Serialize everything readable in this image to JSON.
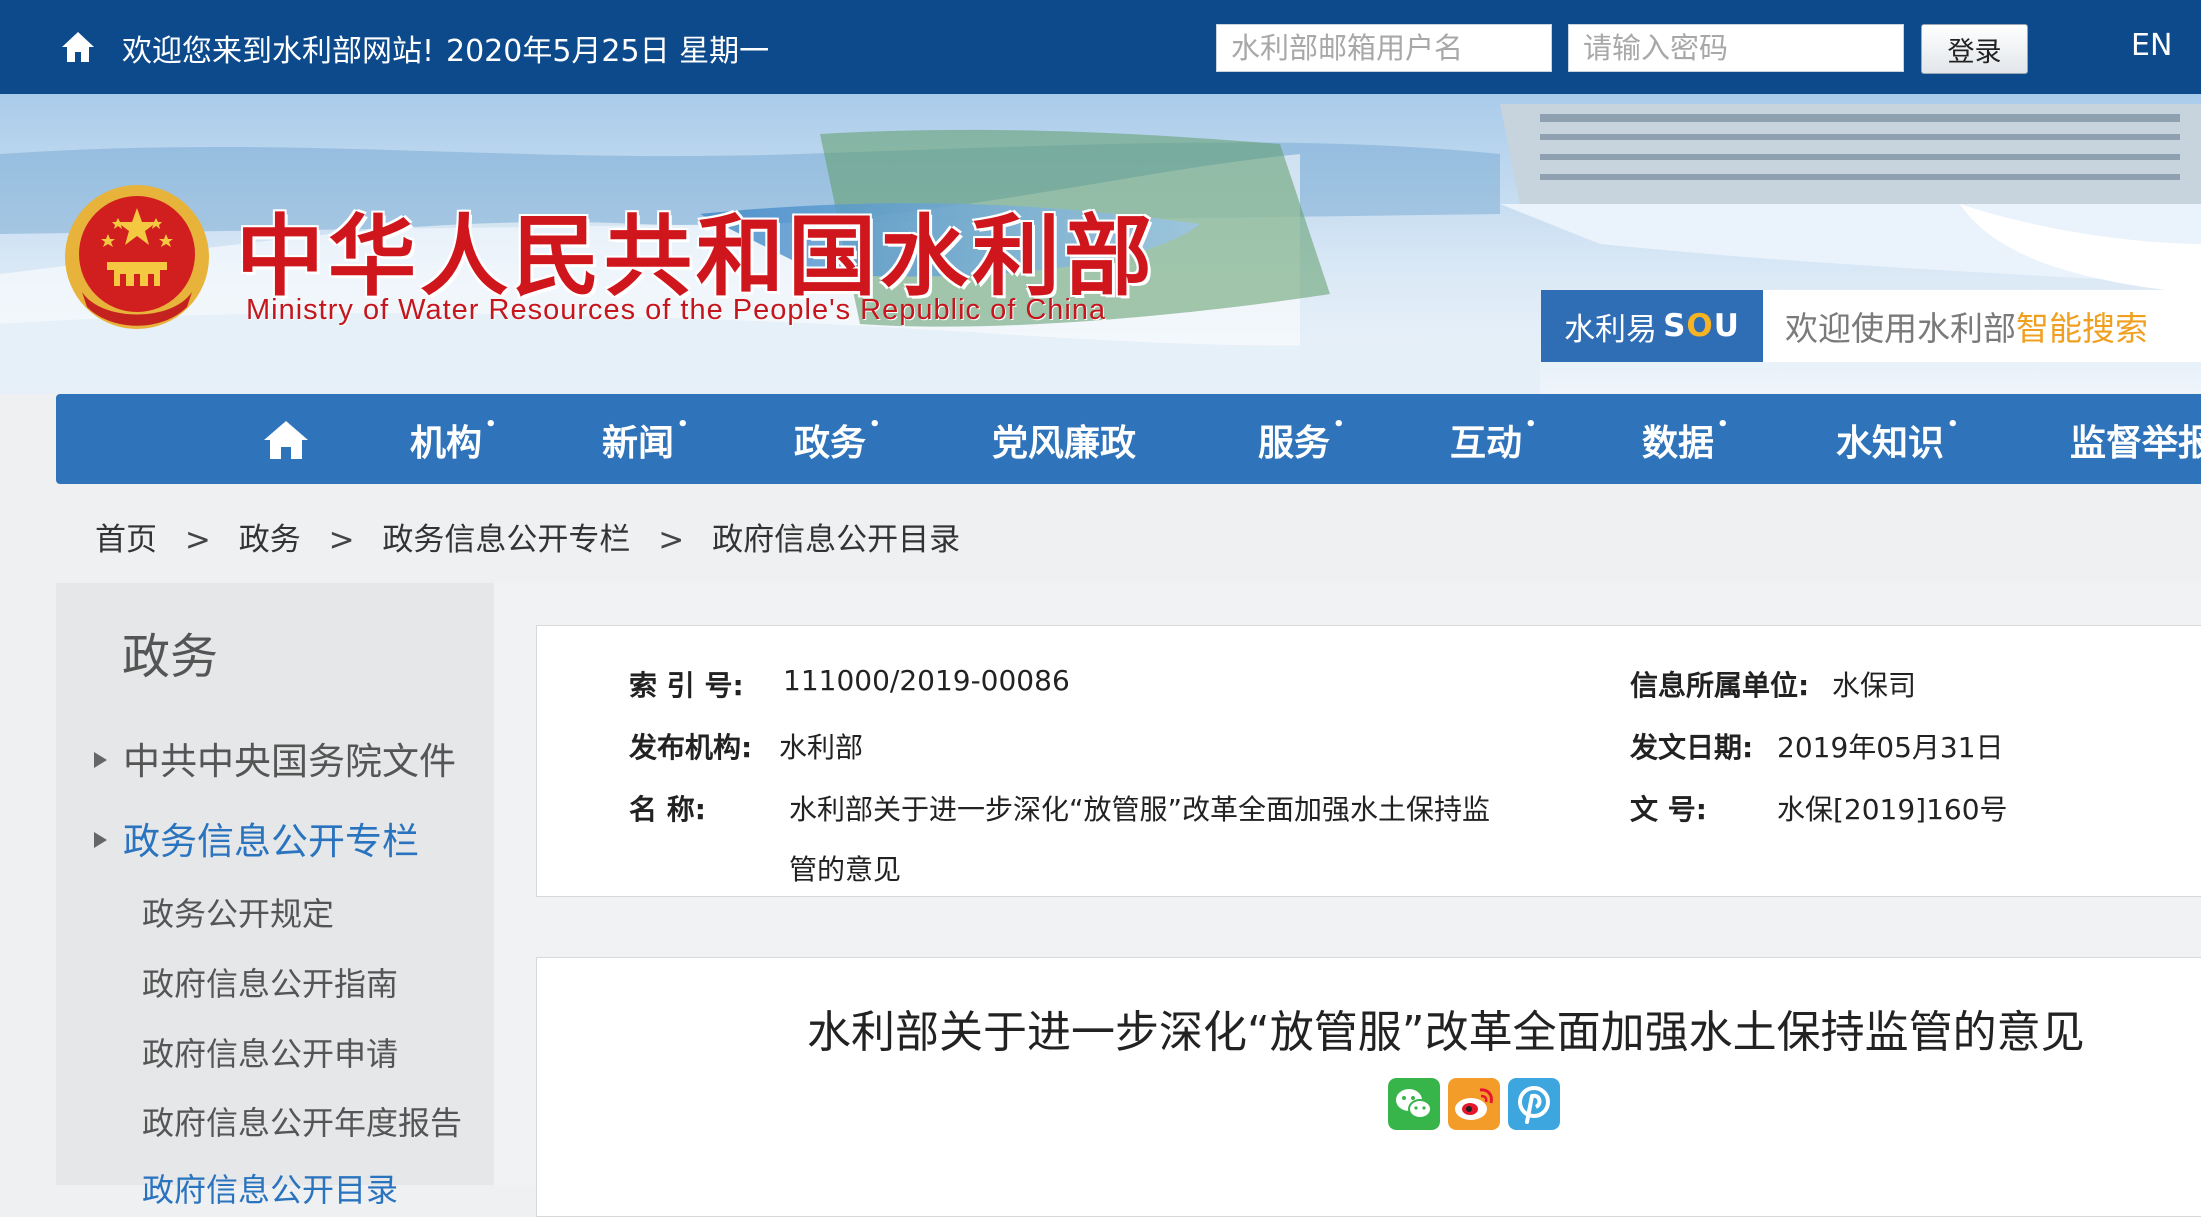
{
  "topbar": {
    "welcome": "欢迎您来到水利部网站!",
    "date": "2020年5月25日 星期一",
    "username_placeholder": "水利部邮箱用户名",
    "password_placeholder": "请输入密码",
    "login_label": "登录",
    "language_label": "EN",
    "home_icon": "home-icon"
  },
  "banner": {
    "title": "中华人民共和国水利部",
    "subtitle": "Ministry of Water Resources of the People's Republic of China",
    "emblem_icon": "national-emblem",
    "search_brand_prefix": "水利易",
    "search_brand_s": "S",
    "search_brand_o": "O",
    "search_brand_u": "U",
    "search_hint_prefix": "欢迎使用水利部",
    "search_hint_highlight": "智能搜索"
  },
  "nav": {
    "home_icon": "home-icon",
    "items": [
      {
        "label": "机构",
        "dropdown": true
      },
      {
        "label": "新闻",
        "dropdown": true
      },
      {
        "label": "政务",
        "dropdown": true
      },
      {
        "label": "党风廉政",
        "dropdown": false
      },
      {
        "label": "服务",
        "dropdown": true
      },
      {
        "label": "互动",
        "dropdown": true
      },
      {
        "label": "数据",
        "dropdown": true
      },
      {
        "label": "水知识",
        "dropdown": true
      },
      {
        "label": "监督举报",
        "dropdown": false
      }
    ],
    "dropdown_marker": "•"
  },
  "breadcrumb": {
    "items": [
      "首页",
      "政务",
      "政务信息公开专栏",
      "政府信息公开目录"
    ],
    "separator": ">"
  },
  "sidebar": {
    "title": "政务",
    "categories": [
      {
        "label": "中共中央国务院文件",
        "active": false
      },
      {
        "label": "政务信息公开专栏",
        "active": true
      }
    ],
    "subitems": [
      {
        "label": "政务公开规定",
        "active": false
      },
      {
        "label": "政府信息公开指南",
        "active": false
      },
      {
        "label": "政府信息公开申请",
        "active": false
      },
      {
        "label": "政府信息公开年度报告",
        "active": false
      },
      {
        "label": "政府信息公开目录",
        "active": true
      }
    ]
  },
  "meta": {
    "index_label": "索  引  号:",
    "index_value": "111000/2019-00086",
    "publisher_label": "发布机构:",
    "publisher_value": "水利部",
    "name_label": "名        称:",
    "name_value_line1": "水利部关于进一步深化“放管服”改革全面加强水土保持监",
    "name_value_line2": "管的意见",
    "unit_label": "信息所属单位:",
    "unit_value": "水保司",
    "date_label": "发文日期:",
    "date_value": "2019年05月31日",
    "doc_no_label": "文        号:",
    "doc_no_value": "水保[2019]160号"
  },
  "document": {
    "title": "水利部关于进一步深化“放管服”改革全面加强水土保持监管的意见",
    "share_icons": [
      "wechat-icon",
      "weibo-icon",
      "pinterest-icon"
    ],
    "colors": {
      "wechat": "#37b44a",
      "weibo": "#e6162d",
      "pin": "#3da6df"
    }
  },
  "colors": {
    "topbar": "#0d4a8c",
    "nav": "#2f73ba",
    "title_red": "#d0161d",
    "link_blue": "#2a73bf",
    "search_brand": "#2f6eb5",
    "search_highlight": "#f0a020"
  }
}
